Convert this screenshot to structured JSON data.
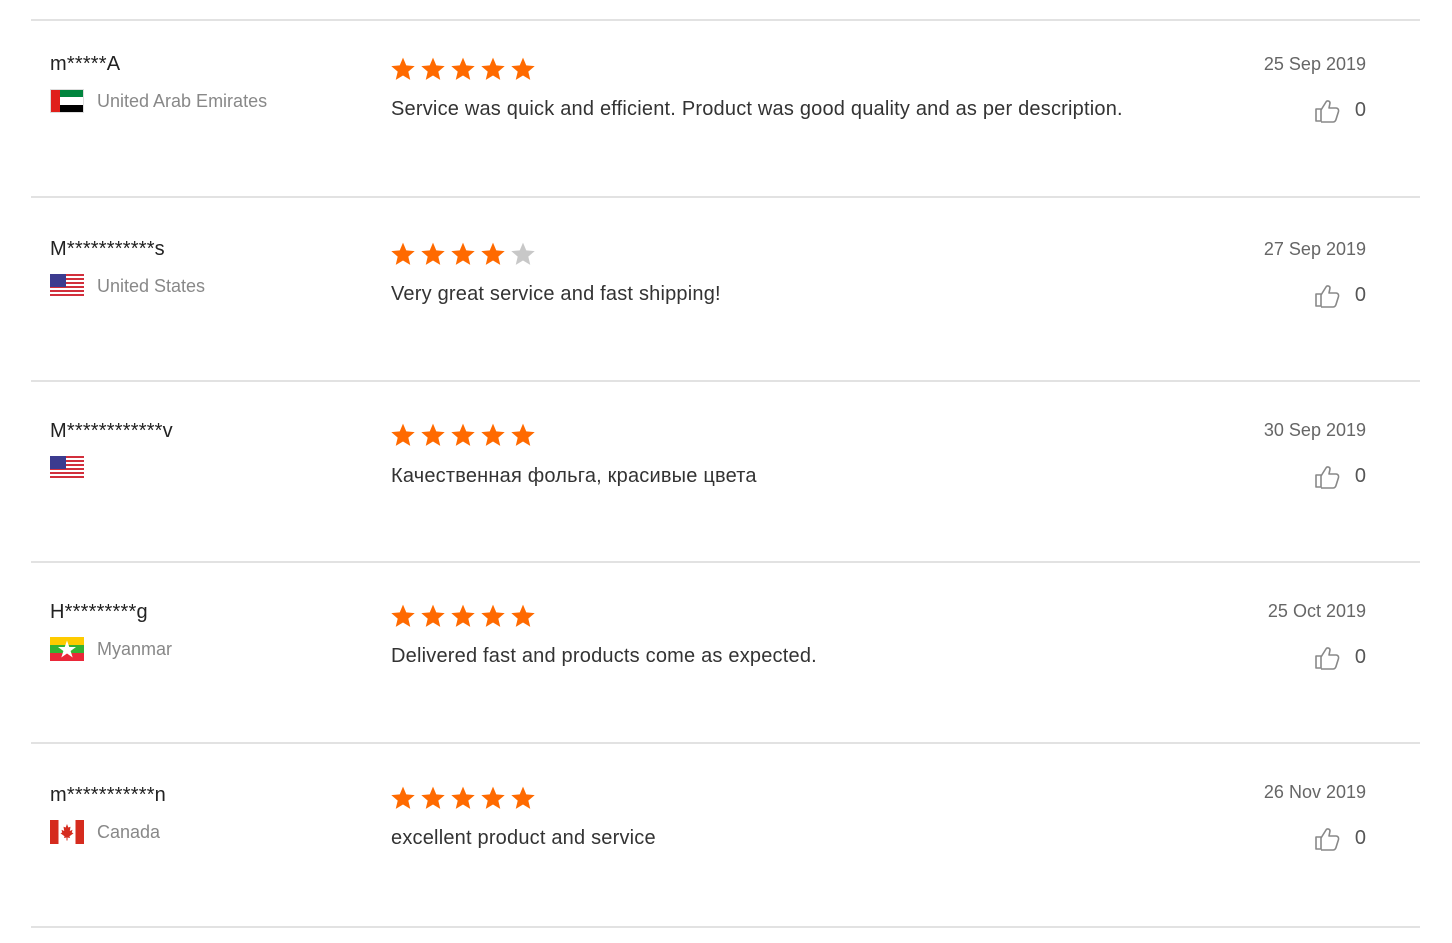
{
  "colors": {
    "star_on": "#ff6a00",
    "star_off": "#c8c8c8",
    "divider": "#e2e2e2"
  },
  "reviews": [
    {
      "name": "m*****A",
      "country": "United Arab Emirates",
      "flag_icon": "flag-uae-icon",
      "rating": 5,
      "comment": "Service was quick and efficient. Product was good quality and as per description.",
      "date": "25 Sep 2019",
      "likes": "0"
    },
    {
      "name": "M***********s",
      "country": "United States",
      "flag_icon": "flag-us-icon",
      "rating": 4,
      "comment": "Very great service and fast shipping!",
      "date": "27 Sep 2019",
      "likes": "0"
    },
    {
      "name": "M************v",
      "country": "",
      "flag_icon": "flag-us-icon",
      "rating": 5,
      "comment": "Качественная фольга, красивые цвета",
      "date": "30 Sep 2019",
      "likes": "0"
    },
    {
      "name": "H*********g",
      "country": "Myanmar",
      "flag_icon": "flag-myanmar-icon",
      "rating": 5,
      "comment": "Delivered fast and products come as expected.",
      "date": "25 Oct 2019",
      "likes": "0"
    },
    {
      "name": "m***********n",
      "country": "Canada",
      "flag_icon": "flag-canada-icon",
      "rating": 5,
      "comment": "excellent product and service",
      "date": "26 Nov 2019",
      "likes": "0"
    }
  ]
}
